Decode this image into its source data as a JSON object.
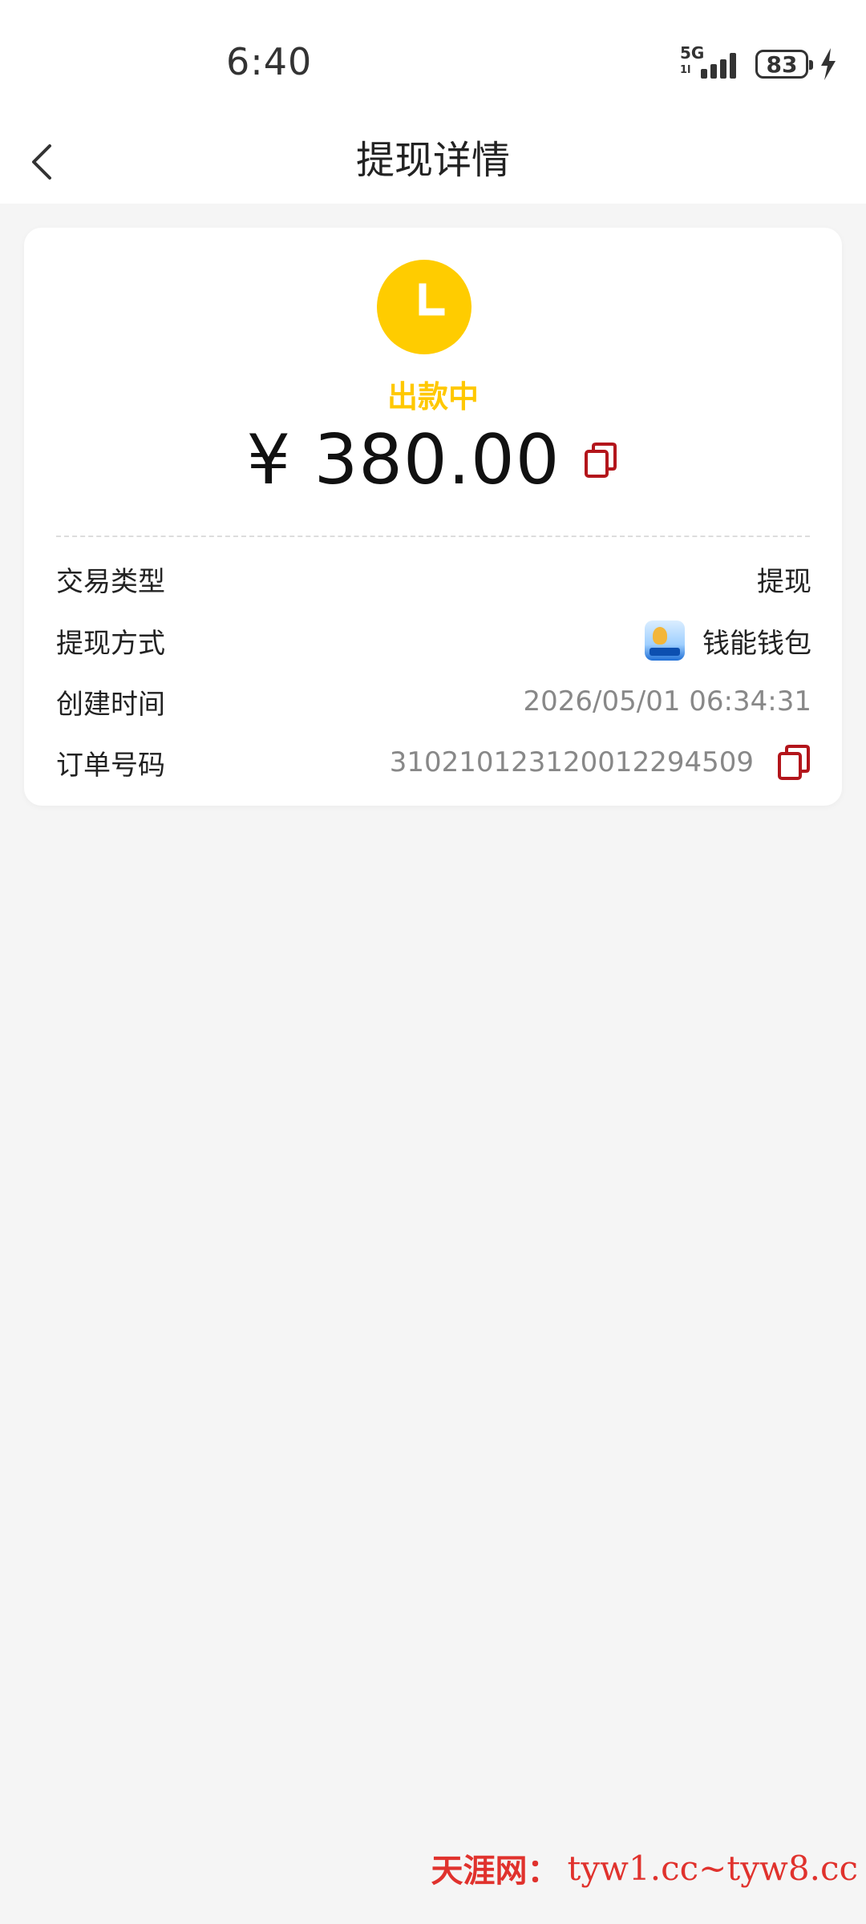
{
  "status_bar": {
    "time": "6:40",
    "network": "5G",
    "network_sub": "1l",
    "battery": "83"
  },
  "nav": {
    "title": "提现详情"
  },
  "summary": {
    "status": "出款中",
    "amount": "¥ 380.00"
  },
  "details": {
    "rows": [
      {
        "label": "交易类型",
        "value": "提现"
      },
      {
        "label": "提现方式",
        "value": "钱能钱包"
      },
      {
        "label": "创建时间",
        "value": "2026/05/01 06:34:31"
      },
      {
        "label": "订单号码",
        "value": "310210123120012294509"
      }
    ]
  },
  "watermark": {
    "site_name": "天涯网：",
    "urls": "tyw1.cc~tyw8.cc"
  },
  "colors": {
    "status_yellow": "#ffcc00",
    "copy_red": "#b3151b",
    "background": "#f5f5f5"
  }
}
